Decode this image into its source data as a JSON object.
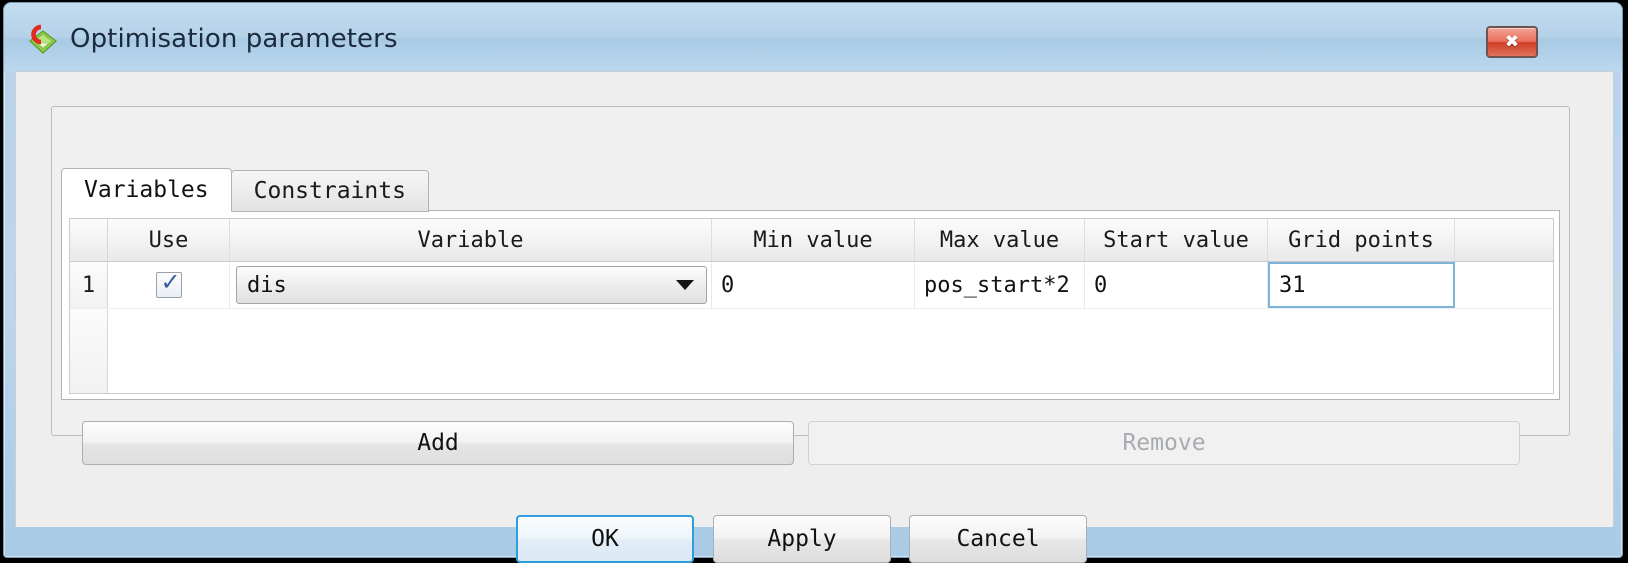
{
  "window": {
    "title": "Optimisation parameters",
    "icon": "app-icon",
    "close_label": "✖"
  },
  "tabs": [
    {
      "label": "Variables",
      "active": true
    },
    {
      "label": "Constraints",
      "active": false
    }
  ],
  "table": {
    "headers": [
      "",
      "Use",
      "Variable",
      "Min value",
      "Max value",
      "Start value",
      "Grid points"
    ],
    "rows": [
      {
        "index": "1",
        "use_checked": true,
        "check_glyph": "✓",
        "variable": "dis",
        "min_value": "0",
        "max_value": "pos_start*2",
        "start_value": "0",
        "grid_points": "31",
        "focused_cell": "grid_points"
      }
    ]
  },
  "row_buttons": {
    "add_label": "Add",
    "remove_label": "Remove",
    "remove_enabled": false
  },
  "dialog_buttons": {
    "ok_label": "OK",
    "apply_label": "Apply",
    "cancel_label": "Cancel",
    "default_button": "OK"
  },
  "colors": {
    "frame": "#b6d2ea",
    "client": "#efeeee",
    "focus_border": "#7eb4d8",
    "default_button_border": "#2f9fdb",
    "close_button": "#cf3f27",
    "disabled_text": "#a7abaf"
  }
}
